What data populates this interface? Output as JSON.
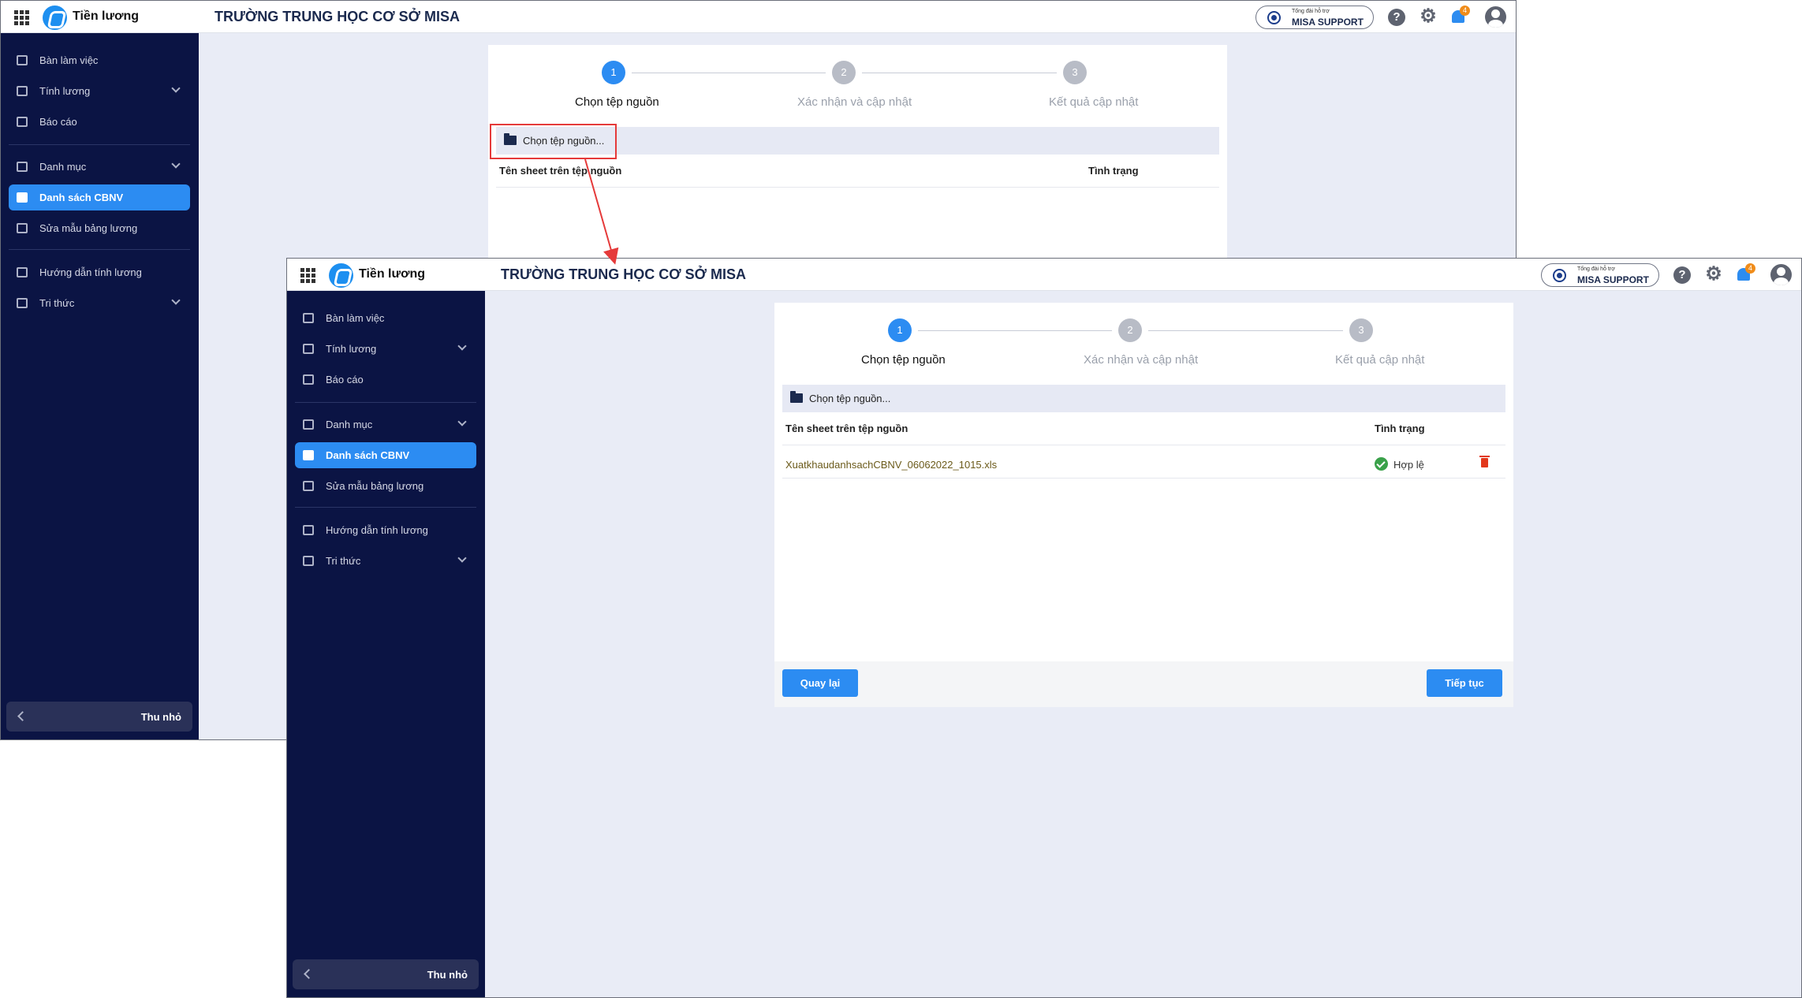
{
  "topbar": {
    "app_name": "Tiền lương",
    "school_title": "TRƯỜNG TRUNG HỌC CƠ SỞ MISA",
    "support_small": "Tổng đài hỗ trợ",
    "support_label": "MISA SUPPORT",
    "help_glyph": "?",
    "gear_glyph": "⚙",
    "notification_count": "4"
  },
  "sidebar": {
    "items": [
      {
        "label": "Bàn làm việc",
        "icon": "dashboard-icon"
      },
      {
        "label": "Tính lương",
        "icon": "wallet-icon"
      },
      {
        "label": "Báo cáo",
        "icon": "report-icon"
      },
      {
        "label": "Danh mục",
        "icon": "list-icon"
      },
      {
        "label": "Danh sách CBNV",
        "icon": "employee-icon"
      },
      {
        "label": "Sửa mẫu bảng lương",
        "icon": "template-icon"
      },
      {
        "label": "Hướng dẫn tính lương",
        "icon": "guide-icon"
      },
      {
        "label": "Tri thức",
        "icon": "knowledge-icon"
      }
    ],
    "collapse_label": "Thu nhỏ"
  },
  "wizard": {
    "steps": [
      {
        "number": "1",
        "label": "Chọn tệp nguồn"
      },
      {
        "number": "2",
        "label": "Xác nhận và cập nhật"
      },
      {
        "number": "3",
        "label": "Kết quả cập nhật"
      }
    ],
    "picker_label": "Chọn tệp nguồn...",
    "columns": [
      "Tên sheet trên tệp nguồn",
      "Tình trạng"
    ],
    "rows": [
      {
        "file": "XuatkhaudanhsachCBNV_06062022_1015.xls",
        "status": "Hợp lệ"
      }
    ],
    "back_label": "Quay lại",
    "next_label": "Tiếp tục"
  },
  "colors": {
    "primary": "#2c8cf2",
    "sidebar_bg": "#0b1444",
    "highlight": "#e53a3a",
    "valid": "#3aa14a",
    "delete": "#e2381c"
  }
}
